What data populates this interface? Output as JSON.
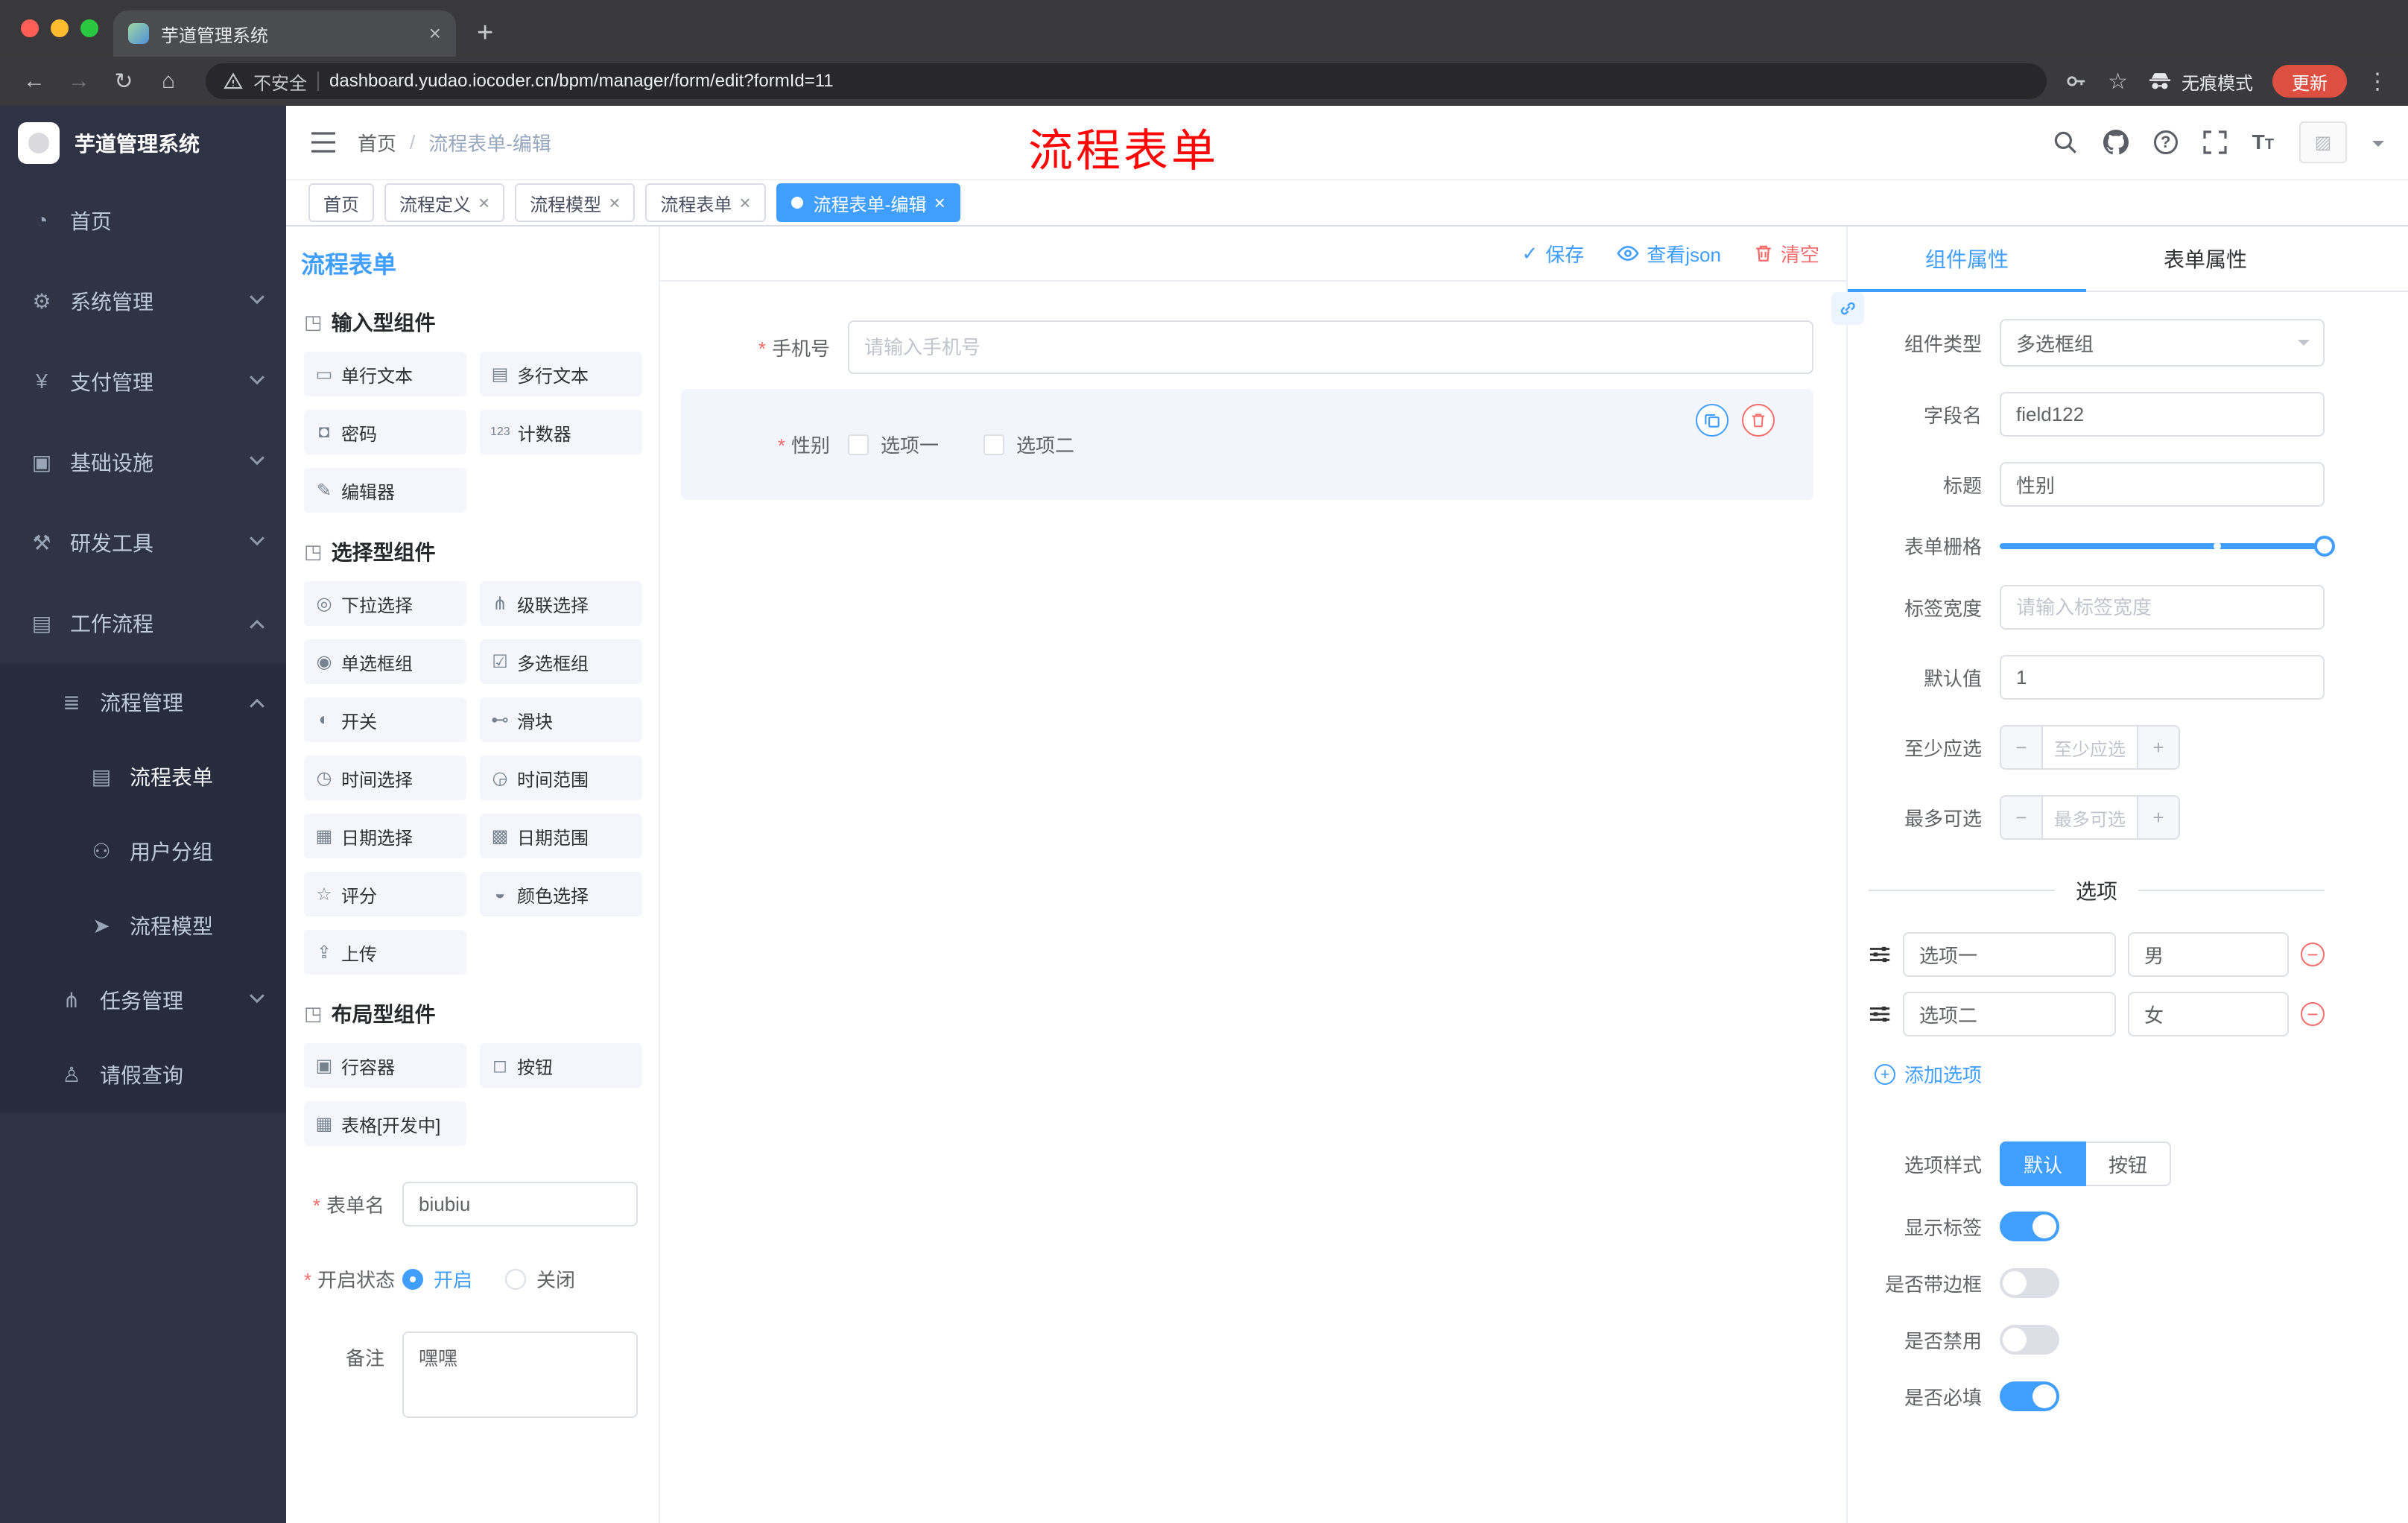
{
  "browser": {
    "tab_title": "芋道管理系统",
    "security_label": "不安全",
    "url_domain": "dashboard.yudao.iocoder.cn",
    "url_path": "/bpm/manager/form/edit?formId=11",
    "incognito_label": "无痕模式",
    "update_label": "更新"
  },
  "sidebar": {
    "logo_title": "芋道管理系统",
    "items": [
      {
        "label": "首页",
        "icon": "dashboard-icon",
        "glyph": "◔"
      },
      {
        "label": "系统管理",
        "icon": "gear-icon",
        "glyph": "⚙"
      },
      {
        "label": "支付管理",
        "icon": "payment-icon",
        "glyph": "¥"
      },
      {
        "label": "基础设施",
        "icon": "infrastructure-icon",
        "glyph": "▣"
      },
      {
        "label": "研发工具",
        "icon": "devtools-icon",
        "glyph": "⚒"
      },
      {
        "label": "工作流程",
        "icon": "workflow-icon",
        "glyph": "▤"
      }
    ],
    "submenu": [
      {
        "label": "流程管理",
        "icon": "process-management-icon",
        "glyph": "≣"
      },
      {
        "label": "流程表单",
        "icon": "process-form-icon",
        "glyph": "▤"
      },
      {
        "label": "用户分组",
        "icon": "user-group-icon",
        "glyph": "⚇"
      },
      {
        "label": "流程模型",
        "icon": "process-model-icon",
        "glyph": "➤"
      },
      {
        "label": "任务管理",
        "icon": "task-management-icon",
        "glyph": "⋔"
      },
      {
        "label": "请假查询",
        "icon": "leave-query-icon",
        "glyph": "♙"
      }
    ]
  },
  "header": {
    "breadcrumb_home": "首页",
    "breadcrumb_current": "流程表单-编辑",
    "annotation": "流程表单"
  },
  "tags": [
    {
      "label": "首页"
    },
    {
      "label": "流程定义"
    },
    {
      "label": "流程模型"
    },
    {
      "label": "流程表单"
    },
    {
      "label": "流程表单-编辑"
    }
  ],
  "designer": {
    "panel_title": "流程表单",
    "groups": [
      {
        "title": "输入型组件",
        "glyph": "◳",
        "items": [
          {
            "label": "单行文本",
            "icon": "single-line-text-icon",
            "glyph": "▭"
          },
          {
            "label": "多行文本",
            "icon": "multi-line-text-icon",
            "glyph": "▤"
          },
          {
            "label": "密码",
            "icon": "password-icon",
            "glyph": "◘"
          },
          {
            "label": "计数器",
            "icon": "counter-icon",
            "glyph": "123"
          },
          {
            "label": "编辑器",
            "icon": "editor-icon",
            "glyph": "✎"
          }
        ]
      },
      {
        "title": "选择型组件",
        "glyph": "◳",
        "items": [
          {
            "label": "下拉选择",
            "icon": "dropdown-select-icon",
            "glyph": "◎"
          },
          {
            "label": "级联选择",
            "icon": "cascader-icon",
            "glyph": "⋔"
          },
          {
            "label": "单选框组",
            "icon": "radio-group-icon",
            "glyph": "◉"
          },
          {
            "label": "多选框组",
            "icon": "checkbox-group-icon",
            "glyph": "☑"
          },
          {
            "label": "开关",
            "icon": "switch-icon",
            "glyph": "◐"
          },
          {
            "label": "滑块",
            "icon": "slider-icon",
            "glyph": "⊷"
          },
          {
            "label": "时间选择",
            "icon": "time-picker-icon",
            "glyph": "◷"
          },
          {
            "label": "时间范围",
            "icon": "time-range-icon",
            "glyph": "◶"
          },
          {
            "label": "日期选择",
            "icon": "date-picker-icon",
            "glyph": "▦"
          },
          {
            "label": "日期范围",
            "icon": "date-range-icon",
            "glyph": "▩"
          },
          {
            "label": "评分",
            "icon": "rate-icon",
            "glyph": "☆"
          },
          {
            "label": "颜色选择",
            "icon": "color-picker-icon",
            "glyph": "◒"
          },
          {
            "label": "上传",
            "icon": "upload-icon",
            "glyph": "⇪"
          }
        ]
      },
      {
        "title": "布局型组件",
        "glyph": "◳",
        "items": [
          {
            "label": "行容器",
            "icon": "row-container-icon",
            "glyph": "▣"
          },
          {
            "label": "按钮",
            "icon": "button-icon",
            "glyph": "◻"
          },
          {
            "label": "表格[开发中]",
            "icon": "table-icon",
            "glyph": "▦"
          }
        ]
      }
    ],
    "form": {
      "name_label": "表单名",
      "name_value": "biubiu",
      "status_label": "开启状态",
      "status_on": "开启",
      "status_off": "关闭",
      "remark_label": "备注",
      "remark_value": "嘿嘿"
    }
  },
  "canvas": {
    "save_label": "保存",
    "view_json_label": "查看json",
    "clear_label": "清空",
    "phone_label": "手机号",
    "phone_placeholder": "请输入手机号",
    "gender_label": "性别",
    "gender_options": [
      {
        "label": "选项一"
      },
      {
        "label": "选项二"
      }
    ]
  },
  "props": {
    "tab_component": "组件属性",
    "tab_form": "表单属性",
    "component_type_label": "组件类型",
    "component_type_value": "多选框组",
    "field_name_label": "字段名",
    "field_name_value": "field122",
    "title_label": "标题",
    "title_value": "性别",
    "grid_label": "表单栅格",
    "label_width_label": "标签宽度",
    "label_width_placeholder": "请输入标签宽度",
    "default_label": "默认值",
    "default_value": "1",
    "min_label": "至少应选",
    "min_placeholder": "至少应选",
    "max_label": "最多可选",
    "max_placeholder": "最多可选",
    "minus_glyph": "−",
    "plus_glyph": "+",
    "options_title": "选项",
    "options": [
      {
        "label": "选项一",
        "value": "男"
      },
      {
        "label": "选项二",
        "value": "女"
      }
    ],
    "add_option_label": "添加选项",
    "option_style_label": "选项样式",
    "style_default": "默认",
    "style_button": "按钮",
    "toggles": [
      {
        "label": "显示标签",
        "on": true
      },
      {
        "label": "是否带边框",
        "on": false
      },
      {
        "label": "是否禁用",
        "on": false
      },
      {
        "label": "是否必填",
        "on": true
      }
    ],
    "slider": {
      "stop_percent": 67
    }
  },
  "colors": {
    "primary": "#409eff",
    "danger": "#f56c6c",
    "annotation_red": "#fe0606"
  }
}
